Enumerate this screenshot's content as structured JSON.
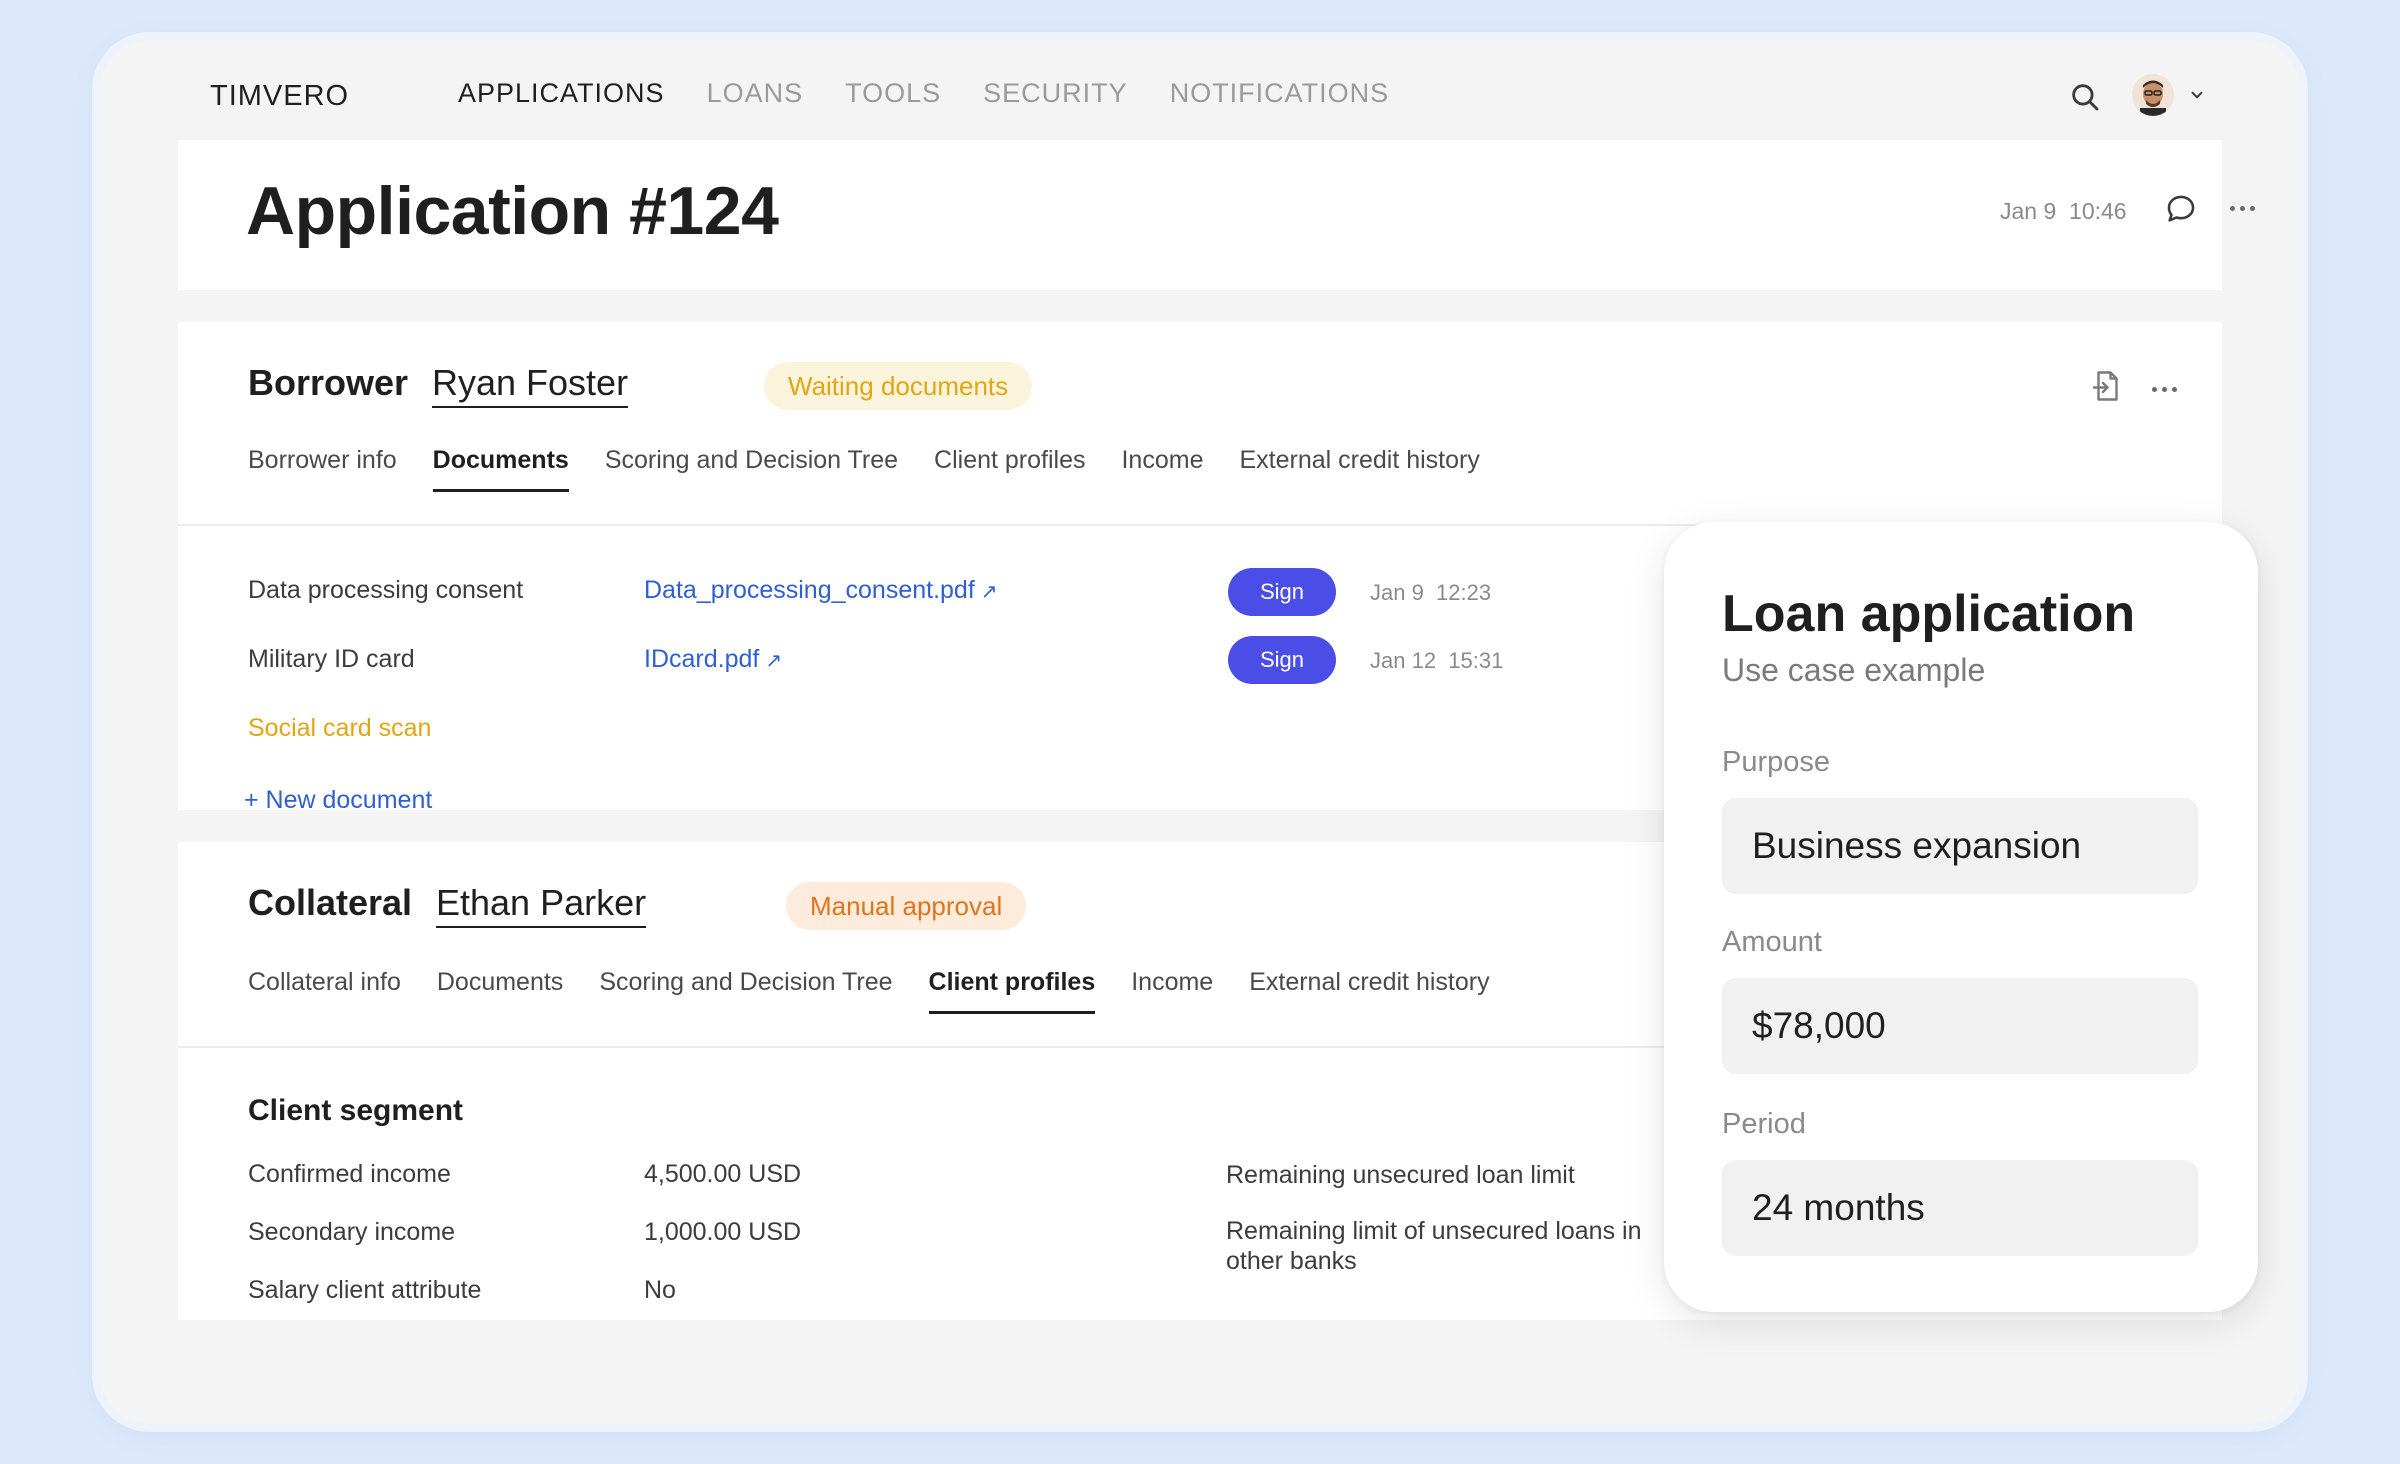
{
  "app": {
    "logo": "TIMVERO"
  },
  "nav": {
    "items": [
      {
        "label": "APPLICATIONS",
        "active": true
      },
      {
        "label": "LOANS",
        "active": false
      },
      {
        "label": "TOOLS",
        "active": false
      },
      {
        "label": "SECURITY",
        "active": false
      },
      {
        "label": "NOTIFICATIONS",
        "active": false
      }
    ]
  },
  "header": {
    "title": "Application #124",
    "date": "Jan 9  10:46"
  },
  "borrower": {
    "label": "Borrower",
    "name": "Ryan Foster",
    "status": "Waiting documents",
    "tabs": [
      "Borrower info",
      "Documents",
      "Scoring and Decision Tree",
      "Client profiles",
      "Income",
      "External credit history"
    ],
    "active_tab": "Documents",
    "documents": [
      {
        "label": "Data processing consent",
        "file": "Data_processing_consent.pdf",
        "action": "Sign",
        "date": "Jan 9  12:23"
      },
      {
        "label": "Military ID card",
        "file": "IDcard.pdf",
        "action": "Sign",
        "date": "Jan 12  15:31"
      },
      {
        "label": "Social card scan"
      }
    ],
    "new_document": "+ New document"
  },
  "collateral": {
    "label": "Collateral",
    "name": "Ethan Parker",
    "status": "Manual approval",
    "tabs": [
      "Collateral info",
      "Documents",
      "Scoring and Decision Tree",
      "Client profiles",
      "Income",
      "External credit history"
    ],
    "active_tab": "Client profiles",
    "segment_title": "Client segment",
    "rows": [
      {
        "label": "Confirmed income",
        "value": "4,500.00 USD"
      },
      {
        "label": "Secondary income",
        "value": "1,000.00 USD"
      },
      {
        "label": "Salary client attribute",
        "value": "No"
      }
    ],
    "right_labels": [
      "Remaining unsecured loan limit",
      "Remaining limit of unsecured loans in other banks"
    ]
  },
  "loan": {
    "title": "Loan application",
    "subtitle": "Use case example",
    "fields": [
      {
        "label": "Purpose",
        "value": "Business expansion"
      },
      {
        "label": "Amount",
        "value": "$78,000"
      },
      {
        "label": "Period",
        "value": "24 months"
      }
    ]
  },
  "icons": {
    "search": "search-icon",
    "comment": "comment-icon",
    "more": "more-icon",
    "exchange": "document-exchange-icon",
    "chevron": "chevron-down-icon",
    "external": "external-link-icon"
  },
  "colors": {
    "accent": "#4a4ee6",
    "link": "#2f5fd0",
    "warning": "#e2a514",
    "orange": "#e0741c",
    "background": "#dce9fb"
  }
}
